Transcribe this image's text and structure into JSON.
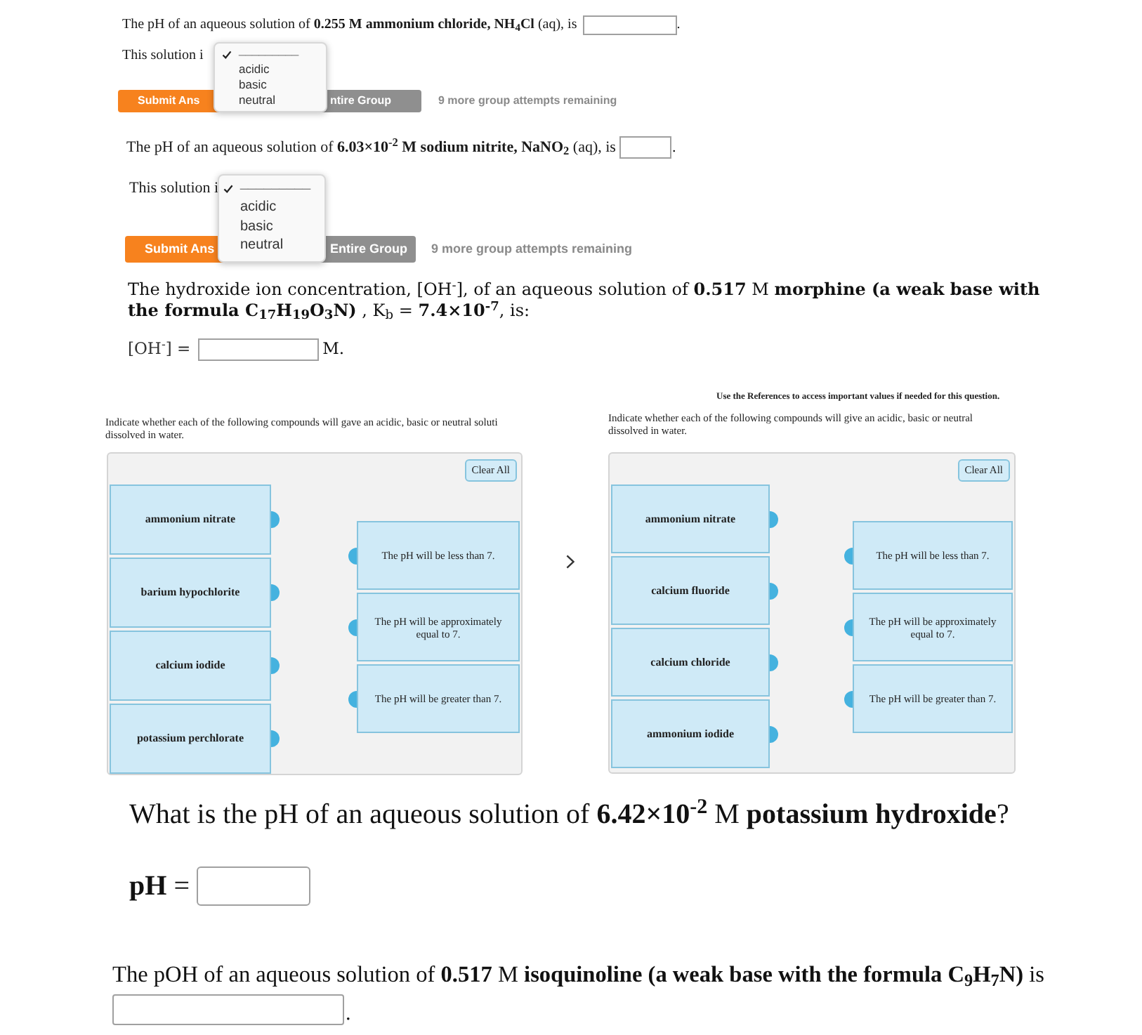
{
  "ph_questions": [
    {
      "prompt": "The pH of an aqueous solution of **0.255 M ammonium chloride, NH$_{4}$Cl** (aq), is",
      "answer_suffix": ".",
      "solution_label": "This solution i",
      "dropdown_options": [
        {
          "label": "_________",
          "selected": true
        },
        {
          "label": "acidic",
          "selected": false
        },
        {
          "label": "basic",
          "selected": false
        },
        {
          "label": "neutral",
          "selected": false
        }
      ],
      "buttons": [
        {
          "kind": "submit",
          "label": "Submit Ans"
        },
        {
          "kind": "group",
          "label": "ntire Group"
        }
      ],
      "attempts": "9 more group attempts remaining"
    },
    {
      "prompt": "The pH of an aqueous solution of **6.03×10$^{-2}$ M sodium nitrite, NaNO$_{2}$** (aq), is",
      "answer_suffix": ".",
      "solution_label": "This solution i",
      "dropdown_options": [
        {
          "label": "_________",
          "selected": true
        },
        {
          "label": "acidic",
          "selected": false
        },
        {
          "label": "basic",
          "selected": false
        },
        {
          "label": "neutral",
          "selected": false
        }
      ],
      "buttons": [
        {
          "kind": "submit",
          "label": "Submit Ans"
        },
        {
          "kind": "group",
          "label": "Entire Group"
        }
      ],
      "attempts": "9 more group attempts remaining"
    }
  ],
  "hydroxide_question": {
    "prompt": "The hydroxide ion concentration, [OH$^{-}$], of an aqueous solution of **0.517** M **morphine (a weak base with the formula C$_{17}$H$_{19}$O$_{3}$N)** , K$_{b}$ = **7.4×10$^{-7}$**, is:",
    "answer_label": "[OH$^{-}$] =",
    "unit": "M."
  },
  "matching_panels": [
    {
      "instructions": [
        "Indicate whether each of the following compounds will gave an acidic, basic or neutral soluti",
        "dissolved in water."
      ],
      "clear_button": "Clear All",
      "compounds": [
        "ammonium nitrate",
        "barium hypochlorite",
        "calcium iodide",
        "potassium perchlorate"
      ],
      "outcomes": [
        "The pH will be less than 7.",
        "The pH will be approximately equal to 7.",
        "The pH will be greater than 7."
      ]
    },
    {
      "references_note": "Use the References to access important values if needed for this question.",
      "instructions": [
        "Indicate whether each of the following compounds will give an acidic, basic or neutral",
        "dissolved in water."
      ],
      "clear_button": "Clear All",
      "compounds": [
        "ammonium nitrate",
        "calcium fluoride",
        "calcium chloride",
        "ammonium iodide"
      ],
      "outcomes": [
        "The pH will be less than 7.",
        "The pH will be approximately equal to 7.",
        "The pH will be greater than 7."
      ]
    }
  ],
  "koh_question": {
    "prompt": "What is the pH of an aqueous solution of **6.42×10$^{-2}$** M **potassium hydroxide**?",
    "answer_label": "**pH** ="
  },
  "isoquinoline_question": {
    "prompt": "The pOH of an aqueous solution of **0.517** M **isoquinoline (a weak base with the formula C$_{9}$H$_{7}$N)** is",
    "answer_suffix": "."
  }
}
